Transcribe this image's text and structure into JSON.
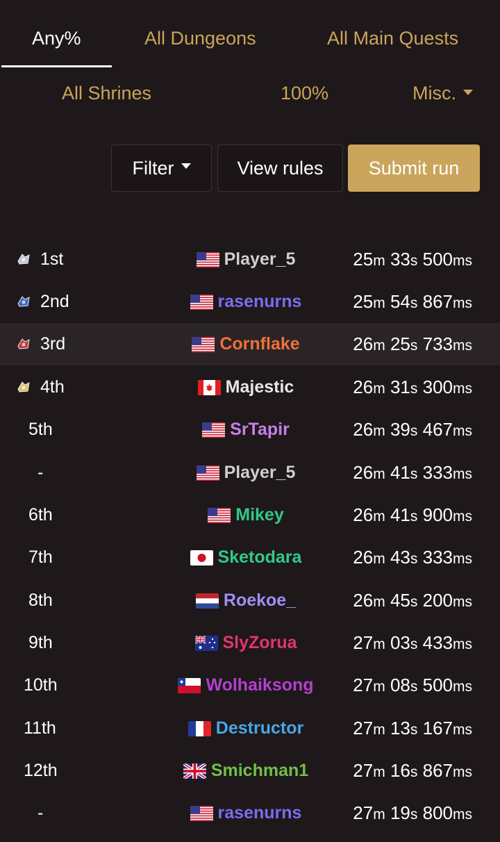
{
  "tabs_row1": [
    {
      "label": "Any%",
      "active": true
    },
    {
      "label": "All Dungeons",
      "active": false
    },
    {
      "label": "All Main Quests",
      "active": false
    }
  ],
  "tabs_row2": [
    {
      "label": "All Shrines"
    },
    {
      "label": "100%"
    },
    {
      "label": "Misc."
    }
  ],
  "buttons": {
    "filter": "Filter",
    "view_rules": "View rules",
    "submit_run": "Submit run"
  },
  "colors": {
    "accent": "#caa55b",
    "background": "#1e181a",
    "highlight_row": "#2b2426"
  },
  "leaderboard": [
    {
      "rank": "1st",
      "trophy": "trophy-1st-icon",
      "flag": "us",
      "player": "Player_5",
      "color": "#cfcfcf",
      "m": "25",
      "s": "33",
      "ms": "500"
    },
    {
      "rank": "2nd",
      "trophy": "trophy-2nd-icon",
      "flag": "us",
      "player": "rasenurns",
      "color": "#7a6cf0",
      "m": "25",
      "s": "54",
      "ms": "867"
    },
    {
      "rank": "3rd",
      "trophy": "trophy-3rd-icon",
      "flag": "us",
      "player": "Cornflake",
      "color": "#f0703a",
      "m": "26",
      "s": "25",
      "ms": "733",
      "highlight": true
    },
    {
      "rank": "4th",
      "trophy": "trophy-4th-icon",
      "flag": "ca",
      "player": "Majestic",
      "color": "#e6e6e6",
      "m": "26",
      "s": "31",
      "ms": "300"
    },
    {
      "rank": "5th",
      "flag": "us",
      "player": "SrTapir",
      "color": "#c77fe8",
      "m": "26",
      "s": "39",
      "ms": "467"
    },
    {
      "rank": "-",
      "flag": "us",
      "player": "Player_5",
      "color": "#cfcfcf",
      "m": "26",
      "s": "41",
      "ms": "333"
    },
    {
      "rank": "6th",
      "flag": "us",
      "player": "Mikey",
      "color": "#2fc98a",
      "m": "26",
      "s": "41",
      "ms": "900"
    },
    {
      "rank": "7th",
      "flag": "jp",
      "player": "Sketodara",
      "color": "#2fc98a",
      "m": "26",
      "s": "43",
      "ms": "333"
    },
    {
      "rank": "8th",
      "flag": "nl",
      "player": "Roekoe_",
      "color": "#9f8ef5",
      "m": "26",
      "s": "45",
      "ms": "200"
    },
    {
      "rank": "9th",
      "flag": "au",
      "player": "SlyZorua",
      "color": "#e0356e",
      "m": "27",
      "s": "03",
      "ms": "433"
    },
    {
      "rank": "10th",
      "flag": "cl",
      "player": "Wolhaiksong",
      "color": "#b43fcf",
      "m": "27",
      "s": "08",
      "ms": "500"
    },
    {
      "rank": "11th",
      "flag": "fr",
      "player": "Destructor",
      "color": "#4aa5ea",
      "m": "27",
      "s": "13",
      "ms": "167"
    },
    {
      "rank": "12th",
      "flag": "gb",
      "player": "Smichman1",
      "color": "#72c045",
      "m": "27",
      "s": "16",
      "ms": "867"
    },
    {
      "rank": "-",
      "flag": "us",
      "player": "rasenurns",
      "color": "#7a6cf0",
      "m": "27",
      "s": "19",
      "ms": "800"
    }
  ]
}
